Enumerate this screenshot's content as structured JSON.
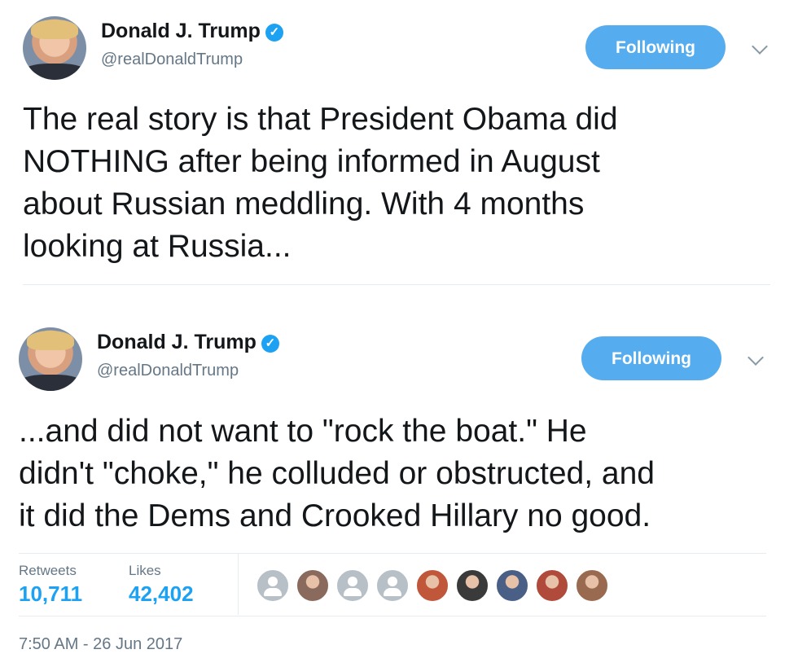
{
  "tweets": [
    {
      "author": {
        "name": "Donald J. Trump",
        "handle": "@realDonaldTrump",
        "verified": true
      },
      "follow_label": "Following",
      "lines": [
        "The real story is that President Obama did",
        "NOTHING after being informed in August",
        "about Russian meddling. With 4 months",
        "looking at Russia..."
      ]
    },
    {
      "author": {
        "name": "Donald J. Trump",
        "handle": "@realDonaldTrump",
        "verified": true
      },
      "follow_label": "Following",
      "lines": [
        "...and did not want to \"rock the boat.\" He",
        "didn't \"choke,\" he colluded or obstructed, and",
        "it did the Dems and Crooked Hillary no good."
      ]
    }
  ],
  "stats": {
    "retweets_label": "Retweets",
    "retweets_value": "10,711",
    "likes_label": "Likes",
    "likes_value": "42,402"
  },
  "likers": [
    {
      "type": "default",
      "color": "#b7bfc7"
    },
    {
      "type": "photo",
      "color": "#8a6a5c"
    },
    {
      "type": "default",
      "color": "#b7bfc7"
    },
    {
      "type": "default",
      "color": "#b7bfc7"
    },
    {
      "type": "photo",
      "color": "#c0563a"
    },
    {
      "type": "photo",
      "color": "#3a3a3a"
    },
    {
      "type": "photo",
      "color": "#4a5f86"
    },
    {
      "type": "photo",
      "color": "#b04a3a"
    },
    {
      "type": "photo",
      "color": "#9a6a50"
    }
  ],
  "timestamp": "7:50 AM - 26 Jun 2017",
  "colors": {
    "accent": "#1da1f2",
    "button": "#55acee",
    "muted": "#657786",
    "divider": "#e6ecf0"
  }
}
